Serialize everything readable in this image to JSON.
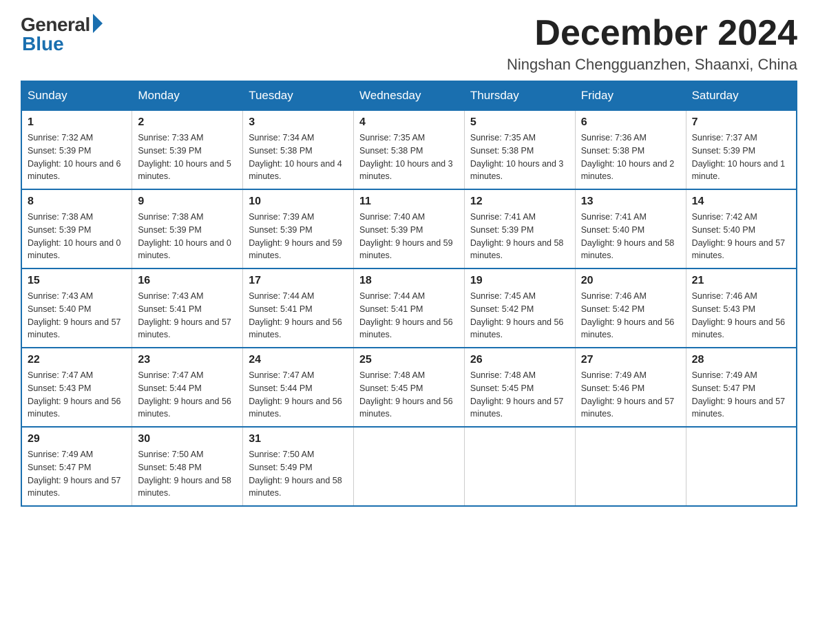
{
  "header": {
    "logo_general": "General",
    "logo_blue": "Blue",
    "month_title": "December 2024",
    "location": "Ningshan Chengguanzhen, Shaanxi, China"
  },
  "weekdays": [
    "Sunday",
    "Monday",
    "Tuesday",
    "Wednesday",
    "Thursday",
    "Friday",
    "Saturday"
  ],
  "weeks": [
    [
      {
        "day": "1",
        "sunrise": "7:32 AM",
        "sunset": "5:39 PM",
        "daylight": "10 hours and 6 minutes."
      },
      {
        "day": "2",
        "sunrise": "7:33 AM",
        "sunset": "5:39 PM",
        "daylight": "10 hours and 5 minutes."
      },
      {
        "day": "3",
        "sunrise": "7:34 AM",
        "sunset": "5:38 PM",
        "daylight": "10 hours and 4 minutes."
      },
      {
        "day": "4",
        "sunrise": "7:35 AM",
        "sunset": "5:38 PM",
        "daylight": "10 hours and 3 minutes."
      },
      {
        "day": "5",
        "sunrise": "7:35 AM",
        "sunset": "5:38 PM",
        "daylight": "10 hours and 3 minutes."
      },
      {
        "day": "6",
        "sunrise": "7:36 AM",
        "sunset": "5:38 PM",
        "daylight": "10 hours and 2 minutes."
      },
      {
        "day": "7",
        "sunrise": "7:37 AM",
        "sunset": "5:39 PM",
        "daylight": "10 hours and 1 minute."
      }
    ],
    [
      {
        "day": "8",
        "sunrise": "7:38 AM",
        "sunset": "5:39 PM",
        "daylight": "10 hours and 0 minutes."
      },
      {
        "day": "9",
        "sunrise": "7:38 AM",
        "sunset": "5:39 PM",
        "daylight": "10 hours and 0 minutes."
      },
      {
        "day": "10",
        "sunrise": "7:39 AM",
        "sunset": "5:39 PM",
        "daylight": "9 hours and 59 minutes."
      },
      {
        "day": "11",
        "sunrise": "7:40 AM",
        "sunset": "5:39 PM",
        "daylight": "9 hours and 59 minutes."
      },
      {
        "day": "12",
        "sunrise": "7:41 AM",
        "sunset": "5:39 PM",
        "daylight": "9 hours and 58 minutes."
      },
      {
        "day": "13",
        "sunrise": "7:41 AM",
        "sunset": "5:40 PM",
        "daylight": "9 hours and 58 minutes."
      },
      {
        "day": "14",
        "sunrise": "7:42 AM",
        "sunset": "5:40 PM",
        "daylight": "9 hours and 57 minutes."
      }
    ],
    [
      {
        "day": "15",
        "sunrise": "7:43 AM",
        "sunset": "5:40 PM",
        "daylight": "9 hours and 57 minutes."
      },
      {
        "day": "16",
        "sunrise": "7:43 AM",
        "sunset": "5:41 PM",
        "daylight": "9 hours and 57 minutes."
      },
      {
        "day": "17",
        "sunrise": "7:44 AM",
        "sunset": "5:41 PM",
        "daylight": "9 hours and 56 minutes."
      },
      {
        "day": "18",
        "sunrise": "7:44 AM",
        "sunset": "5:41 PM",
        "daylight": "9 hours and 56 minutes."
      },
      {
        "day": "19",
        "sunrise": "7:45 AM",
        "sunset": "5:42 PM",
        "daylight": "9 hours and 56 minutes."
      },
      {
        "day": "20",
        "sunrise": "7:46 AM",
        "sunset": "5:42 PM",
        "daylight": "9 hours and 56 minutes."
      },
      {
        "day": "21",
        "sunrise": "7:46 AM",
        "sunset": "5:43 PM",
        "daylight": "9 hours and 56 minutes."
      }
    ],
    [
      {
        "day": "22",
        "sunrise": "7:47 AM",
        "sunset": "5:43 PM",
        "daylight": "9 hours and 56 minutes."
      },
      {
        "day": "23",
        "sunrise": "7:47 AM",
        "sunset": "5:44 PM",
        "daylight": "9 hours and 56 minutes."
      },
      {
        "day": "24",
        "sunrise": "7:47 AM",
        "sunset": "5:44 PM",
        "daylight": "9 hours and 56 minutes."
      },
      {
        "day": "25",
        "sunrise": "7:48 AM",
        "sunset": "5:45 PM",
        "daylight": "9 hours and 56 minutes."
      },
      {
        "day": "26",
        "sunrise": "7:48 AM",
        "sunset": "5:45 PM",
        "daylight": "9 hours and 57 minutes."
      },
      {
        "day": "27",
        "sunrise": "7:49 AM",
        "sunset": "5:46 PM",
        "daylight": "9 hours and 57 minutes."
      },
      {
        "day": "28",
        "sunrise": "7:49 AM",
        "sunset": "5:47 PM",
        "daylight": "9 hours and 57 minutes."
      }
    ],
    [
      {
        "day": "29",
        "sunrise": "7:49 AM",
        "sunset": "5:47 PM",
        "daylight": "9 hours and 57 minutes."
      },
      {
        "day": "30",
        "sunrise": "7:50 AM",
        "sunset": "5:48 PM",
        "daylight": "9 hours and 58 minutes."
      },
      {
        "day": "31",
        "sunrise": "7:50 AM",
        "sunset": "5:49 PM",
        "daylight": "9 hours and 58 minutes."
      },
      null,
      null,
      null,
      null
    ]
  ],
  "cell_labels": {
    "sunrise_prefix": "Sunrise: ",
    "sunset_prefix": "Sunset: ",
    "daylight_prefix": "Daylight: "
  }
}
